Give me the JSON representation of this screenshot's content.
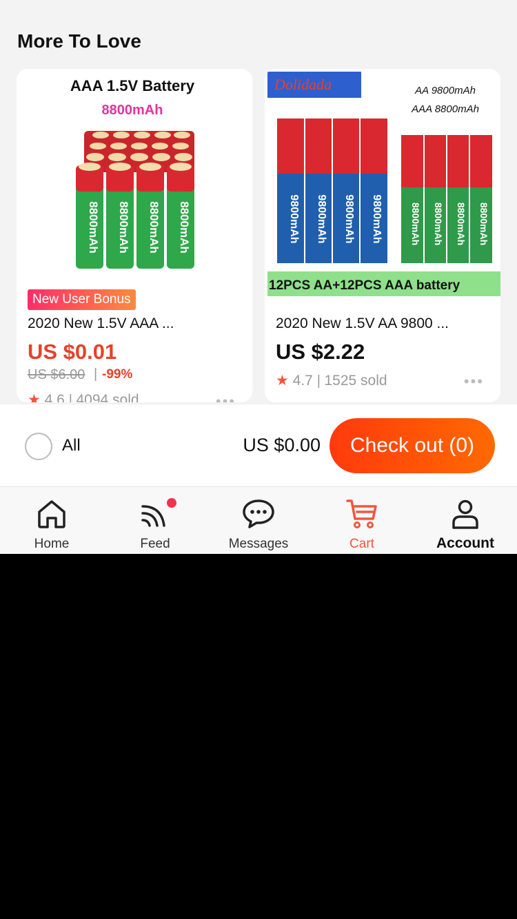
{
  "section": {
    "title": "More To Love"
  },
  "products": [
    {
      "image": {
        "heading": "AAA 1.5V Battery",
        "capacity": "8800mAh",
        "cell_text": "8800mAh"
      },
      "badge": "New User Bonus",
      "title": "2020 New 1.5V AAA ...",
      "price": "US $0.01",
      "original_price": "US $6.00",
      "discount": "-99%",
      "rating": "4.6",
      "sold": "4094 sold",
      "price_color": "#e8402a"
    },
    {
      "image": {
        "brand": "Dolidada",
        "line1": "AA 9800mAh",
        "line2": "AAA 8800mAh",
        "cell_text_aa": "9800mAh",
        "cell_text_aaa": "8800mAh",
        "banner": "12PCS AA+12PCS AAA battery"
      },
      "title": "2020 New 1.5V AA 9800 ...",
      "price": "US $2.22",
      "rating": "4.7",
      "sold": "1525 sold",
      "price_color": "#111111"
    }
  ],
  "checkout_bar": {
    "select_all_label": "All",
    "total": "US $0.00",
    "checkout_label": "Check out (0)",
    "accent": "#ff4a0a"
  },
  "tabbar": {
    "items": [
      {
        "label": "Home",
        "icon": "home-icon"
      },
      {
        "label": "Feed",
        "icon": "feed-icon",
        "notification_dot": true
      },
      {
        "label": "Messages",
        "icon": "chat-icon"
      },
      {
        "label": "Cart",
        "icon": "cart-icon",
        "active": true
      },
      {
        "label": "Account",
        "icon": "person-icon"
      }
    ],
    "active_color": "#f2553f"
  }
}
